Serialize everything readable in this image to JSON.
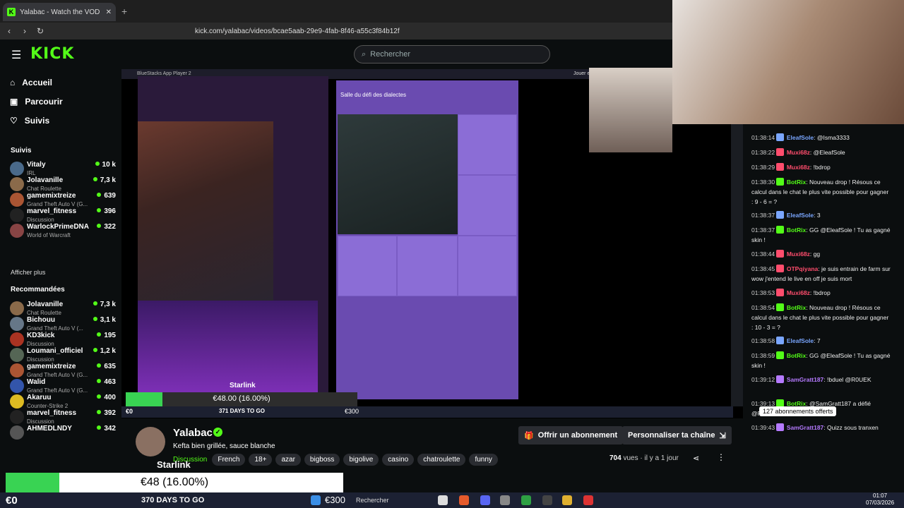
{
  "browser": {
    "tab_title": "Yalabac - Watch the VOD on",
    "tab_close": "✕",
    "new_tab": "+",
    "url": "kick.com/yalabac/videos/bcae5aab-29e9-4fab-8f46-a55c3f84b12f"
  },
  "header": {
    "logo": "KICK",
    "search_placeholder": "Rechercher"
  },
  "nav": [
    {
      "label": "Accueil",
      "icon": "home-icon",
      "glyph": "⌂"
    },
    {
      "label": "Parcourir",
      "icon": "browse-icon",
      "glyph": "▣"
    },
    {
      "label": "Suivis",
      "icon": "heart-icon",
      "glyph": "♡"
    }
  ],
  "followed": {
    "heading": "Suivis",
    "items": [
      {
        "name": "Vitaly",
        "category": "IRL",
        "viewers": "10 k",
        "color": "#4a6a8a"
      },
      {
        "name": "Jolavanille",
        "category": "Chat Roulette",
        "viewers": "7,3 k",
        "color": "#8a6a4a"
      },
      {
        "name": "gamemixtreize",
        "category": "Grand Theft Auto V (G...",
        "viewers": "639",
        "color": "#aa5533"
      },
      {
        "name": "marvel_fitness",
        "category": "Discussion",
        "viewers": "396",
        "color": "#222"
      },
      {
        "name": "WarlockPrimeDNA",
        "category": "World of Warcraft",
        "viewers": "322",
        "color": "#884444"
      }
    ],
    "show_more": "Afficher plus"
  },
  "recommended": {
    "heading": "Recommandées",
    "items": [
      {
        "name": "Jolavanille",
        "category": "Chat Roulette",
        "viewers": "7,3 k",
        "color": "#8a6a4a"
      },
      {
        "name": "Bichouu",
        "category": "Grand Theft Auto V (...",
        "viewers": "3,1 k",
        "color": "#667788"
      },
      {
        "name": "KD3kick",
        "category": "Discussion",
        "viewers": "195",
        "color": "#aa3322"
      },
      {
        "name": "Loumani_officiel",
        "category": "Discussion",
        "viewers": "1,2 k",
        "color": "#556655"
      },
      {
        "name": "gamemixtreize",
        "category": "Grand Theft Auto V (G...",
        "viewers": "635",
        "color": "#aa5533"
      },
      {
        "name": "Walid",
        "category": "Grand Theft Auto V (G...",
        "viewers": "463",
        "color": "#3355aa"
      },
      {
        "name": "Akaruu",
        "category": "Counter-Strike 2",
        "viewers": "400",
        "color": "#ddbb22"
      },
      {
        "name": "marvel_fitness",
        "category": "Discussion",
        "viewers": "392",
        "color": "#222"
      },
      {
        "name": "AHMEDLNDY",
        "category": "",
        "viewers": "342",
        "color": "#555"
      }
    ]
  },
  "overlay_small": {
    "goal_text": "€48.00 (16.00%)",
    "progress": 0.16,
    "starlink": "Starlink",
    "left_label": "€0",
    "days": "371 DAYS TO GO",
    "right_label": "€300",
    "search": "Rechercher"
  },
  "overlay_big": {
    "goal_text": "€48 (16.00%)",
    "progress": 0.16,
    "starlink": "Starlink",
    "left_label": "€0",
    "days": "370 DAYS TO GO",
    "right_label": "€300",
    "search": "Rechercher",
    "time": "01:07",
    "date": "07/03/2026"
  },
  "channel": {
    "name": "Yalabac",
    "subtitle": "Kefta bien grillée, sauce blanche",
    "category": "Discussion",
    "tags": [
      "French",
      "18+",
      "azar",
      "bigboss",
      "bigolive",
      "casino",
      "chatroulette",
      "funny"
    ],
    "subscribe_btn": "Offrir un abonnement",
    "customize_btn": "Personnaliser ta chaîne",
    "views_count": "704",
    "views_label": "vues",
    "ago": "il y a 1 jour"
  },
  "chat": {
    "messages": [
      {
        "time": "01:38:14",
        "user": "EleafSole",
        "user_color": "#7aa6ff",
        "text": ": @Isma3333"
      },
      {
        "time": "01:38:22",
        "user": "Muxi68z",
        "user_color": "#ff4d6d",
        "text": ": @EleafSole"
      },
      {
        "time": "01:38:29",
        "user": "Muxi68z",
        "user_color": "#ff4d6d",
        "text": ": !bdrop"
      },
      {
        "time": "01:38:30",
        "user": "BotRix",
        "user_color": "#53fc18",
        "text": ": Nouveau drop ! Résous ce calcul dans le chat le plus vite possible pour gagner : 9 - 6 = ?"
      },
      {
        "time": "01:38:37",
        "user": "EleafSole",
        "user_color": "#7aa6ff",
        "text": ": 3"
      },
      {
        "time": "01:38:37",
        "user": "BotRix",
        "user_color": "#53fc18",
        "text": ": GG @EleafSole ! Tu as gagné skin !"
      },
      {
        "time": "01:38:44",
        "user": "Muxi68z",
        "user_color": "#ff4d6d",
        "text": ": gg"
      },
      {
        "time": "01:38:45",
        "user": "OTPqiyana",
        "user_color": "#ff4d6d",
        "text": ": je suis entrain de farm sur wow j'entend le live en off je suis mort"
      },
      {
        "time": "01:38:53",
        "user": "Muxi68z",
        "user_color": "#ff4d6d",
        "text": ": !bdrop"
      },
      {
        "time": "01:38:54",
        "user": "BotRix",
        "user_color": "#53fc18",
        "text": ": Nouveau drop ! Résous ce calcul dans le chat le plus vite possible pour gagner : 10 - 3 = ?"
      },
      {
        "time": "01:38:58",
        "user": "EleafSole",
        "user_color": "#7aa6ff",
        "text": ": 7"
      },
      {
        "time": "01:38:59",
        "user": "BotRix",
        "user_color": "#53fc18",
        "text": ": GG @EleafSole ! Tu as gagné skin !"
      },
      {
        "time": "01:39:12",
        "user": "SamGratt187",
        "user_color": "#b57aff",
        "text": ": !bduel @R0UEK"
      },
      {
        "time": "01:39:13",
        "user": "BotRix",
        "user_color": "#53fc18",
        "text": ": @SamGratt187 a défié @R0UEK"
      },
      {
        "time": "01:39:43",
        "user": "SamGratt187",
        "user_color": "#b57aff",
        "text": ": Quizz sous tranxen"
      }
    ],
    "toast": "127 abonnements offerts"
  },
  "video": {
    "app_title": "BlueStacks App Player 2",
    "left_time": "01:07",
    "right_time": "01:07",
    "room_title": "Salle du défi des dialectes",
    "right_top": "Jouer et"
  }
}
